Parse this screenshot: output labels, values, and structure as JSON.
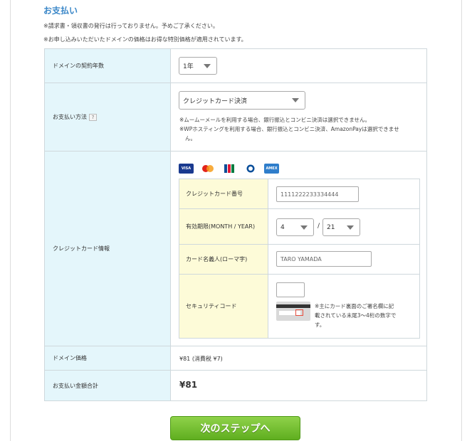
{
  "title": "お支払い",
  "notes": [
    "※請求書・領収書の発行は行っておりません。予めご了承ください。",
    "※お申し込みいただいたドメインの価格はお得な特別価格が適用されています。"
  ],
  "rows": {
    "term": {
      "label": "ドメインの契約年数",
      "selected": "1年"
    },
    "method": {
      "label": "お支払い方法",
      "help": "?",
      "selected": "クレジットカード決済",
      "note1": "※ムームーメールを利用する場合、銀行振込とコンビニ決済は選択できません。",
      "note2a": "※WPホスティングを利用する場合、銀行振込とコンビニ決済、AmazonPayは選択できませ",
      "note2b": "ん。"
    },
    "card": {
      "label": "クレジットカード情報",
      "brands": [
        "VISA",
        "MC",
        "JCB",
        "DC",
        "AMEX"
      ],
      "number_label": "クレジットカード番号",
      "number_value": "1111222233334444",
      "expiry_label": "有効期限(MONTH / YEAR)",
      "month": "4",
      "slash": "/",
      "year": "21",
      "name_label": "カード名義人(ローマ字)",
      "name_value": "TARO YAMADA",
      "cvc_label": "セキュリティコード",
      "cvc_value": "",
      "cvc_note1": "※主にカード裏面のご署名欄に記",
      "cvc_note2": "載されている末尾3～4桁の数字で",
      "cvc_note3": "す。"
    },
    "price": {
      "label": "ドメイン価格",
      "value": "¥81 (消費税 ¥7)"
    },
    "total": {
      "label": "お支払い金額合計",
      "value": "¥81"
    }
  },
  "next_button": "次のステップへ",
  "colors": {
    "accent": "#3a87c8",
    "label_bg": "#e4f6fb",
    "inner_label_bg": "#fdfbd8",
    "button": "#6dbb2a"
  }
}
